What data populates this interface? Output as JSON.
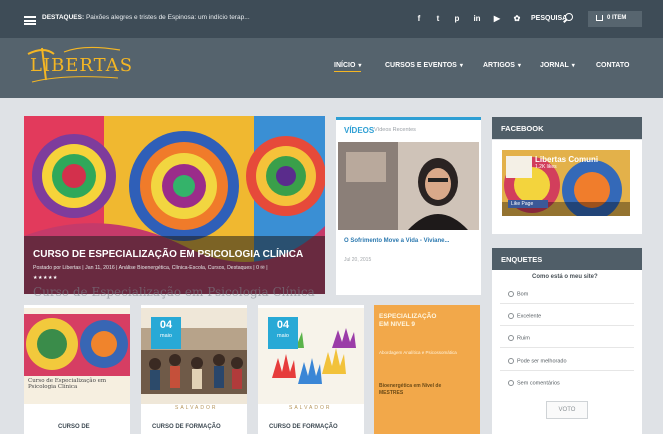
{
  "topbar": {
    "destaques_label": "DESTAQUES:",
    "destaques_text": "Paixões alegres e tristes de Espinosa: um indício terap...",
    "social": [
      {
        "icon": "facebook-icon",
        "glyph": "f"
      },
      {
        "icon": "twitter-icon",
        "glyph": "t"
      },
      {
        "icon": "pinterest-icon",
        "glyph": "p"
      },
      {
        "icon": "linkedin-icon",
        "glyph": "in"
      },
      {
        "icon": "youtube-icon",
        "glyph": "▶"
      },
      {
        "icon": "flickr-icon",
        "glyph": "✿"
      }
    ],
    "search_label": "PESQUISA",
    "cart_label": "0 ITEM"
  },
  "header": {
    "logo_text": "LIBERTAS",
    "nav": [
      {
        "label": "INÍCIO",
        "active": true
      },
      {
        "label": "CURSOS E EVENTOS",
        "active": false
      },
      {
        "label": "ARTIGOS",
        "active": false
      },
      {
        "label": "JORNAL",
        "active": false
      },
      {
        "label": "CONTATO",
        "active": false
      }
    ]
  },
  "hero": {
    "title": "CURSO DE ESPECIALIZAÇÃO EM PSICOLOGIA CLÍNICA",
    "meta": "Postado por Libertas | Jan 11, 2016 | Análise Bioenergética, Clínica-Escola, Cursos, Destaques | 0 ✉ |",
    "stars": "★★★★★",
    "ghost_text": "Curso de Especialização em Psicologia Clínica"
  },
  "videos": {
    "title": "VÍDEOS",
    "subtitle": "Vídeos Recentes",
    "video_title": "O Sofrimento Move a Vida - Viviane...",
    "video_date": "Jul 20, 2015"
  },
  "facebook": {
    "title": "FACEBOOK",
    "page_name": "Libertas Comuni",
    "likes": "1.2K likes",
    "like_button": "Like Page"
  },
  "poll": {
    "title": "ENQUETES",
    "question": "Como está o meu site?",
    "options": [
      "Bom",
      "Excelente",
      "Ruim",
      "Pode ser melhorado",
      "Sem comentários"
    ],
    "vote_label": "VOTO"
  },
  "cards": [
    {
      "title": "CURSO DE",
      "has_date": false
    },
    {
      "title": "CURSO DE FORMAÇÃO",
      "has_date": true,
      "day": "04",
      "month": "maio",
      "city": "SALVADOR"
    },
    {
      "title": "CURSO DE FORMAÇÃO",
      "has_date": true,
      "day": "04",
      "month": "maio",
      "city": "SALVADOR"
    }
  ],
  "card0": {
    "caption": "Curso de Especialização em Psicologia Clínica"
  },
  "promo": {
    "heading": "ESPECIALIZAÇÃO EM NIVEL 9",
    "text": "Abordagem Analítica e Psicossomática",
    "text2": "Bioenergética em Nível de MESTRES"
  },
  "colors": {
    "accent": "#28a9d6",
    "topbar": "#3e4c57",
    "header": "#55636d",
    "brand_gold": "#f4b624"
  }
}
